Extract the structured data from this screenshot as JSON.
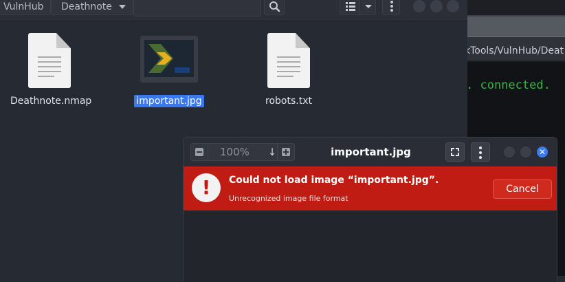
{
  "file_manager": {
    "breadcrumbs": [
      "VulnHub",
      "Deathnote"
    ],
    "icons": {
      "search": "search-icon",
      "view": "list-view-icon",
      "view_menu": "chevron-down-icon",
      "menu": "vertical-dots-icon"
    },
    "files": [
      {
        "name": "Deathnote.nmap",
        "icon": "text-document-icon",
        "selected": false
      },
      {
        "name": "important.jpg",
        "icon": "image-thumbnail",
        "selected": true
      },
      {
        "name": "robots.txt",
        "icon": "text-document-icon",
        "selected": false
      }
    ]
  },
  "terminal": {
    "path_fragment": "kTools/VulnHub/Deat",
    "output_fragment": ". connected."
  },
  "image_viewer": {
    "title": "important.jpg",
    "zoom": "100%",
    "error": {
      "title": "Could not load image “important.jpg”.",
      "subtitle": "Unrecognized image file format",
      "cancel_label": "Cancel"
    }
  },
  "colors": {
    "error_bar": "#c01c13",
    "selection": "#3a78f2",
    "terminal_green": "#3db24a",
    "close_button": "#3b7bf0"
  }
}
